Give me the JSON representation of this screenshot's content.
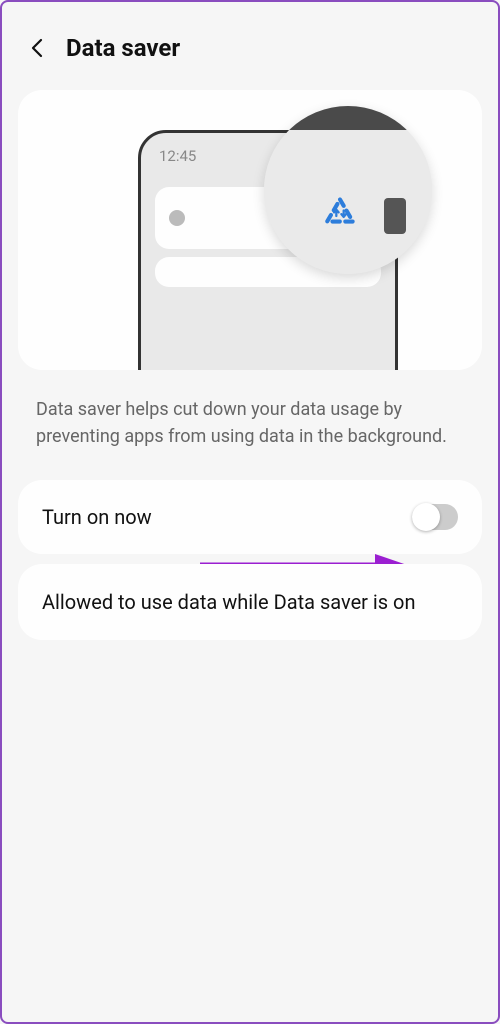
{
  "header": {
    "title": "Data saver"
  },
  "illustration": {
    "time": "12:45"
  },
  "description": "Data saver helps cut down your data usage by preventing apps from using data in the background.",
  "settings": {
    "turn_on": {
      "label": "Turn on now",
      "enabled": false
    },
    "allowed": {
      "label": "Allowed to use data while Data saver is on"
    }
  }
}
